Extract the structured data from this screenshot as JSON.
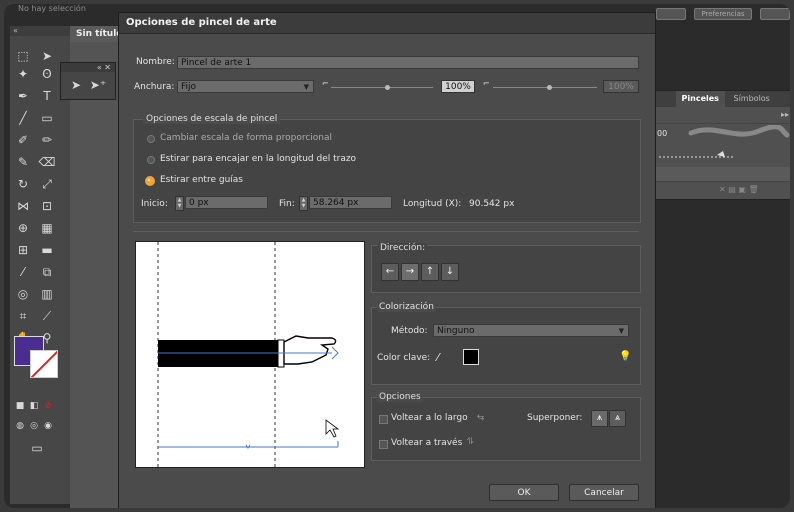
{
  "app": {
    "top_left_text": "No hay selección",
    "doc_tab": "Sin título"
  },
  "right_panel": {
    "tabs": [
      "Pinceles",
      "Símbolos"
    ],
    "top_pill": "Preferencias",
    "size_label": "00"
  },
  "dialog": {
    "title": "Opciones de pincel de arte",
    "name_label": "Nombre:",
    "name_value": "Pincel de arte 1",
    "width_label": "Anchura:",
    "width_value": "Fijo",
    "width_pct": "100%",
    "width_pct2": "100%",
    "scale_group_title": "Opciones de escala de pincel",
    "scale_options": [
      "Cambiar escala de forma proporcional",
      "Estirar para encajar en la longitud del trazo",
      "Estirar entre guías"
    ],
    "scale_selected": 2,
    "start_label": "Inicio:",
    "start_value": "0 px",
    "end_label": "Fin:",
    "end_value": "58.264 px",
    "length_label": "Longitud (X):",
    "length_value": "90.542 px",
    "direction_title": "Dirección:",
    "direction_icons": [
      "←",
      "→",
      "↑",
      "↓"
    ],
    "colorization_title": "Colorización",
    "method_label": "Método:",
    "method_value": "Ninguno",
    "key_color_label": "Color clave:",
    "options_title": "Opciones",
    "flip_along": "Voltear a lo largo",
    "flip_across": "Voltear a través",
    "overlap_label": "Superponer:",
    "ok": "OK",
    "cancel": "Cancelar"
  },
  "colors": {
    "fill_swatch": "#4a2d91",
    "accent_radio": "#f3a33b",
    "guide_blue": "#4a74d8"
  }
}
